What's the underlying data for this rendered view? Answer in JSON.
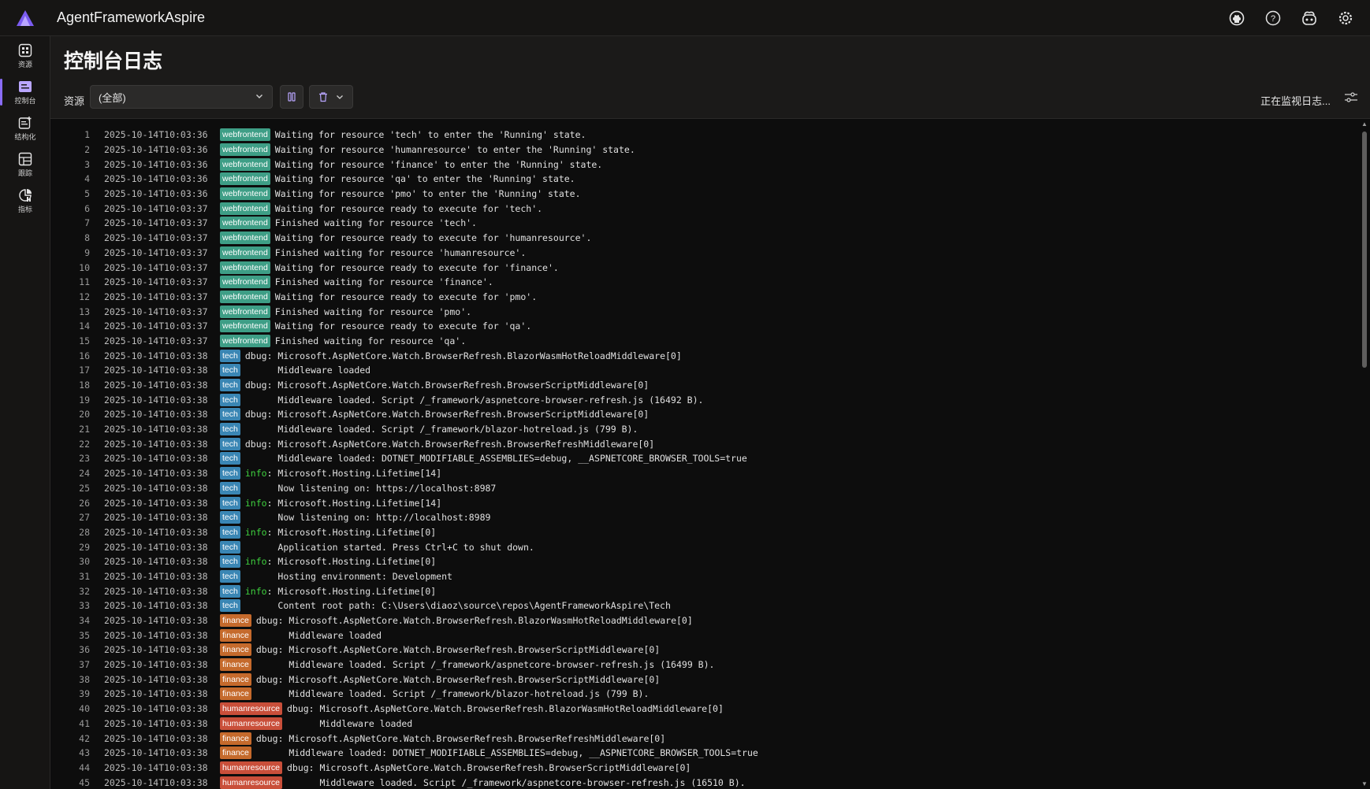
{
  "app": {
    "title": "AgentFrameworkAspire"
  },
  "nav": [
    {
      "label": "资源",
      "icon": "resources-icon"
    },
    {
      "label": "控制台",
      "icon": "console-icon",
      "active": true
    },
    {
      "label": "结构化",
      "icon": "structured-icon"
    },
    {
      "label": "跟踪",
      "icon": "traces-icon"
    },
    {
      "label": "指标",
      "icon": "metrics-icon"
    }
  ],
  "page": {
    "title": "控制台日志"
  },
  "toolbar": {
    "resource_label": "资源",
    "resource_selected": "(全部)",
    "status": "正在监视日志..."
  },
  "colors": {
    "webfrontend": "#3e9e86",
    "tech": "#3a86b4",
    "finance": "#c56a2c",
    "humanresource": "#c94f3a",
    "info": "#3fd23f",
    "accent": "#8a6cf7"
  },
  "logs": [
    {
      "n": "1",
      "ts": "2025-10-14T10:03:36",
      "res": "webfrontend",
      "lvl": "",
      "msg": "Waiting for resource 'tech' to enter the 'Running' state."
    },
    {
      "n": "2",
      "ts": "2025-10-14T10:03:36",
      "res": "webfrontend",
      "lvl": "",
      "msg": "Waiting for resource 'humanresource' to enter the 'Running' state."
    },
    {
      "n": "3",
      "ts": "2025-10-14T10:03:36",
      "res": "webfrontend",
      "lvl": "",
      "msg": "Waiting for resource 'finance' to enter the 'Running' state."
    },
    {
      "n": "4",
      "ts": "2025-10-14T10:03:36",
      "res": "webfrontend",
      "lvl": "",
      "msg": "Waiting for resource 'qa' to enter the 'Running' state."
    },
    {
      "n": "5",
      "ts": "2025-10-14T10:03:36",
      "res": "webfrontend",
      "lvl": "",
      "msg": "Waiting for resource 'pmo' to enter the 'Running' state."
    },
    {
      "n": "6",
      "ts": "2025-10-14T10:03:37",
      "res": "webfrontend",
      "lvl": "",
      "msg": "Waiting for resource ready to execute for 'tech'."
    },
    {
      "n": "7",
      "ts": "2025-10-14T10:03:37",
      "res": "webfrontend",
      "lvl": "",
      "msg": "Finished waiting for resource 'tech'."
    },
    {
      "n": "8",
      "ts": "2025-10-14T10:03:37",
      "res": "webfrontend",
      "lvl": "",
      "msg": "Waiting for resource ready to execute for 'humanresource'."
    },
    {
      "n": "9",
      "ts": "2025-10-14T10:03:37",
      "res": "webfrontend",
      "lvl": "",
      "msg": "Finished waiting for resource 'humanresource'."
    },
    {
      "n": "10",
      "ts": "2025-10-14T10:03:37",
      "res": "webfrontend",
      "lvl": "",
      "msg": "Waiting for resource ready to execute for 'finance'."
    },
    {
      "n": "11",
      "ts": "2025-10-14T10:03:37",
      "res": "webfrontend",
      "lvl": "",
      "msg": "Finished waiting for resource 'finance'."
    },
    {
      "n": "12",
      "ts": "2025-10-14T10:03:37",
      "res": "webfrontend",
      "lvl": "",
      "msg": "Waiting for resource ready to execute for 'pmo'."
    },
    {
      "n": "13",
      "ts": "2025-10-14T10:03:37",
      "res": "webfrontend",
      "lvl": "",
      "msg": "Finished waiting for resource 'pmo'."
    },
    {
      "n": "14",
      "ts": "2025-10-14T10:03:37",
      "res": "webfrontend",
      "lvl": "",
      "msg": "Waiting for resource ready to execute for 'qa'."
    },
    {
      "n": "15",
      "ts": "2025-10-14T10:03:37",
      "res": "webfrontend",
      "lvl": "",
      "msg": "Finished waiting for resource 'qa'."
    },
    {
      "n": "16",
      "ts": "2025-10-14T10:03:38",
      "res": "tech",
      "lvl": "dbug",
      "msg": "Microsoft.AspNetCore.Watch.BrowserRefresh.BlazorWasmHotReloadMiddleware[0]"
    },
    {
      "n": "17",
      "ts": "2025-10-14T10:03:38",
      "res": "tech",
      "lvl": "",
      "msg": "      Middleware loaded"
    },
    {
      "n": "18",
      "ts": "2025-10-14T10:03:38",
      "res": "tech",
      "lvl": "dbug",
      "msg": "Microsoft.AspNetCore.Watch.BrowserRefresh.BrowserScriptMiddleware[0]"
    },
    {
      "n": "19",
      "ts": "2025-10-14T10:03:38",
      "res": "tech",
      "lvl": "",
      "msg": "      Middleware loaded. Script /_framework/aspnetcore-browser-refresh.js (16492 B)."
    },
    {
      "n": "20",
      "ts": "2025-10-14T10:03:38",
      "res": "tech",
      "lvl": "dbug",
      "msg": "Microsoft.AspNetCore.Watch.BrowserRefresh.BrowserScriptMiddleware[0]"
    },
    {
      "n": "21",
      "ts": "2025-10-14T10:03:38",
      "res": "tech",
      "lvl": "",
      "msg": "      Middleware loaded. Script /_framework/blazor-hotreload.js (799 B)."
    },
    {
      "n": "22",
      "ts": "2025-10-14T10:03:38",
      "res": "tech",
      "lvl": "dbug",
      "msg": "Microsoft.AspNetCore.Watch.BrowserRefresh.BrowserRefreshMiddleware[0]"
    },
    {
      "n": "23",
      "ts": "2025-10-14T10:03:38",
      "res": "tech",
      "lvl": "",
      "msg": "      Middleware loaded: DOTNET_MODIFIABLE_ASSEMBLIES=debug, __ASPNETCORE_BROWSER_TOOLS=true"
    },
    {
      "n": "24",
      "ts": "2025-10-14T10:03:38",
      "res": "tech",
      "lvl": "info",
      "msg": "Microsoft.Hosting.Lifetime[14]"
    },
    {
      "n": "25",
      "ts": "2025-10-14T10:03:38",
      "res": "tech",
      "lvl": "",
      "msg": "      Now listening on: https://localhost:8987"
    },
    {
      "n": "26",
      "ts": "2025-10-14T10:03:38",
      "res": "tech",
      "lvl": "info",
      "msg": "Microsoft.Hosting.Lifetime[14]"
    },
    {
      "n": "27",
      "ts": "2025-10-14T10:03:38",
      "res": "tech",
      "lvl": "",
      "msg": "      Now listening on: http://localhost:8989"
    },
    {
      "n": "28",
      "ts": "2025-10-14T10:03:38",
      "res": "tech",
      "lvl": "info",
      "msg": "Microsoft.Hosting.Lifetime[0]"
    },
    {
      "n": "29",
      "ts": "2025-10-14T10:03:38",
      "res": "tech",
      "lvl": "",
      "msg": "      Application started. Press Ctrl+C to shut down."
    },
    {
      "n": "30",
      "ts": "2025-10-14T10:03:38",
      "res": "tech",
      "lvl": "info",
      "msg": "Microsoft.Hosting.Lifetime[0]"
    },
    {
      "n": "31",
      "ts": "2025-10-14T10:03:38",
      "res": "tech",
      "lvl": "",
      "msg": "      Hosting environment: Development"
    },
    {
      "n": "32",
      "ts": "2025-10-14T10:03:38",
      "res": "tech",
      "lvl": "info",
      "msg": "Microsoft.Hosting.Lifetime[0]"
    },
    {
      "n": "33",
      "ts": "2025-10-14T10:03:38",
      "res": "tech",
      "lvl": "",
      "msg": "      Content root path: C:\\Users\\diaoz\\source\\repos\\AgentFrameworkAspire\\Tech"
    },
    {
      "n": "34",
      "ts": "2025-10-14T10:03:38",
      "res": "finance",
      "lvl": "dbug",
      "msg": "Microsoft.AspNetCore.Watch.BrowserRefresh.BlazorWasmHotReloadMiddleware[0]"
    },
    {
      "n": "35",
      "ts": "2025-10-14T10:03:38",
      "res": "finance",
      "lvl": "",
      "msg": "      Middleware loaded"
    },
    {
      "n": "36",
      "ts": "2025-10-14T10:03:38",
      "res": "finance",
      "lvl": "dbug",
      "msg": "Microsoft.AspNetCore.Watch.BrowserRefresh.BrowserScriptMiddleware[0]"
    },
    {
      "n": "37",
      "ts": "2025-10-14T10:03:38",
      "res": "finance",
      "lvl": "",
      "msg": "      Middleware loaded. Script /_framework/aspnetcore-browser-refresh.js (16499 B)."
    },
    {
      "n": "38",
      "ts": "2025-10-14T10:03:38",
      "res": "finance",
      "lvl": "dbug",
      "msg": "Microsoft.AspNetCore.Watch.BrowserRefresh.BrowserScriptMiddleware[0]"
    },
    {
      "n": "39",
      "ts": "2025-10-14T10:03:38",
      "res": "finance",
      "lvl": "",
      "msg": "      Middleware loaded. Script /_framework/blazor-hotreload.js (799 B)."
    },
    {
      "n": "40",
      "ts": "2025-10-14T10:03:38",
      "res": "humanresource",
      "lvl": "dbug",
      "msg": "Microsoft.AspNetCore.Watch.BrowserRefresh.BlazorWasmHotReloadMiddleware[0]"
    },
    {
      "n": "41",
      "ts": "2025-10-14T10:03:38",
      "res": "humanresource",
      "lvl": "",
      "msg": "      Middleware loaded"
    },
    {
      "n": "42",
      "ts": "2025-10-14T10:03:38",
      "res": "finance",
      "lvl": "dbug",
      "msg": "Microsoft.AspNetCore.Watch.BrowserRefresh.BrowserRefreshMiddleware[0]"
    },
    {
      "n": "43",
      "ts": "2025-10-14T10:03:38",
      "res": "finance",
      "lvl": "",
      "msg": "      Middleware loaded: DOTNET_MODIFIABLE_ASSEMBLIES=debug, __ASPNETCORE_BROWSER_TOOLS=true"
    },
    {
      "n": "44",
      "ts": "2025-10-14T10:03:38",
      "res": "humanresource",
      "lvl": "dbug",
      "msg": "Microsoft.AspNetCore.Watch.BrowserRefresh.BrowserScriptMiddleware[0]"
    },
    {
      "n": "45",
      "ts": "2025-10-14T10:03:38",
      "res": "humanresource",
      "lvl": "",
      "msg": "      Middleware loaded. Script /_framework/aspnetcore-browser-refresh.js (16510 B)."
    }
  ]
}
